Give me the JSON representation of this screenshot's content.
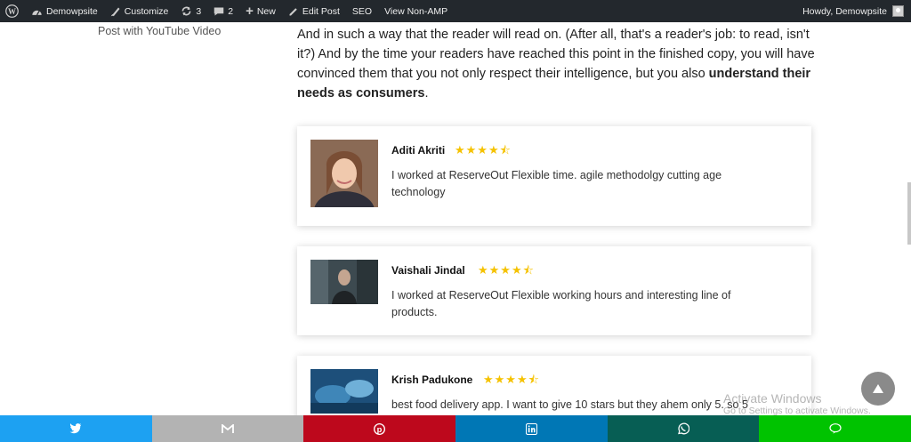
{
  "adminbar": {
    "site_name": "Demowpsite",
    "customize": "Customize",
    "updates_count": "3",
    "comments_count": "2",
    "new_label": "New",
    "edit_post": "Edit Post",
    "seo": "SEO",
    "view_non_amp": "View Non-AMP",
    "howdy": "Howdy, Demowpsite"
  },
  "sidebar": {
    "link": "Post with YouTube Video"
  },
  "article": {
    "p1": "And in such a way that the reader will read on. (After all, that's a reader's job: to read, isn't it?) And by the time your readers have reached this point in the finished copy, you will have convinced them that you not only respect their intelligence, but you also",
    "p1_bold": "understand their needs as consumers",
    "p1_end": "."
  },
  "reviews": [
    {
      "name": "Aditi Akriti",
      "rating": 4.5,
      "stars": "★★★★⯪",
      "text": "I worked at ReserveOut Flexible time. agile methodolgy cutting age technology"
    },
    {
      "name": "Vaishali Jindal",
      "rating": 4.5,
      "stars": "★★★★⯪",
      "text": "I worked at ReserveOut Flexible working hours and interesting line of products."
    },
    {
      "name": "Krish Padukone",
      "rating": 4.5,
      "stars": "★★★★⯪",
      "text": "best food delivery app. I want to give 10 stars but they ahem only 5. so 5"
    }
  ],
  "watermark": {
    "line1": "Activate Windows",
    "line2": "Go to Settings to activate Windows."
  },
  "share": [
    {
      "name": "twitter",
      "icon": "twitter-icon",
      "color": "#1da1f2"
    },
    {
      "name": "gmail",
      "icon": "mail-icon",
      "color": "#b3b3b3"
    },
    {
      "name": "pinterest",
      "icon": "pinterest-icon",
      "color": "#bd081c"
    },
    {
      "name": "linkedin",
      "icon": "linkedin-icon",
      "color": "#0077b5"
    },
    {
      "name": "whatsapp",
      "icon": "whatsapp-icon",
      "color": "#075e54"
    },
    {
      "name": "line",
      "icon": "line-icon",
      "color": "#00c300"
    }
  ],
  "colors": {
    "adminbar": "#23282d",
    "star": "#f5c200"
  }
}
